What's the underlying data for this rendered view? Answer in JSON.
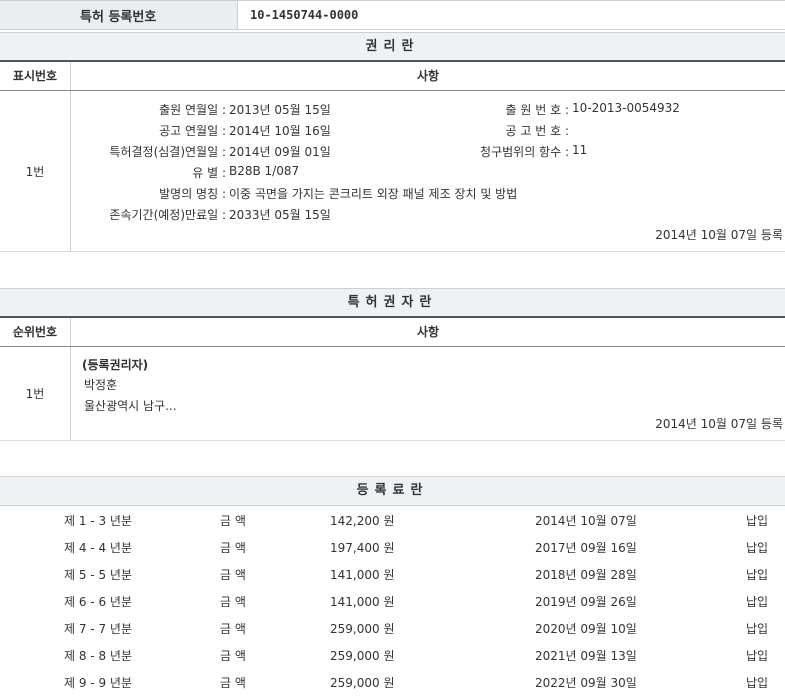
{
  "top": {
    "label": "특허 등록번호",
    "value": "10-1450744-0000"
  },
  "rights": {
    "title": "권리란",
    "col_num": "표시번호",
    "col_item": "사항",
    "num": "1번",
    "fields_left": [
      {
        "k": "출원 연월일 :",
        "v": "2013년 05월 15일"
      },
      {
        "k": "공고 연월일 :",
        "v": "2014년 10월 16일"
      },
      {
        "k": "특허결정(심결)연월일 :",
        "v": "2014년 09월 01일"
      },
      {
        "k": "유  별 :",
        "v": "B28B 1/087"
      },
      {
        "k": "발명의 명칭 :",
        "v": "이중 곡면을 가지는 콘크리트 외장 패널 제조 장치 및 방법"
      },
      {
        "k": "존속기간(예정)만료일 :",
        "v": "2033년 05월 15일"
      }
    ],
    "fields_right": [
      {
        "k": "출 원 번 호 :",
        "v": "10-2013-0054932"
      },
      {
        "k": "공 고 번 호 :",
        "v": ""
      },
      {
        "k": "청구범위의 항수 :",
        "v": "11"
      }
    ],
    "date": "2014년 10월 07일 등록"
  },
  "holders": {
    "title": "특허권자란",
    "col_num": "순위번호",
    "col_item": "사항",
    "num": "1번",
    "heading": "(등록권리자)",
    "name": "박정훈",
    "address": "울산광역시 남구...",
    "date": "2014년 10월 07일 등록"
  },
  "fees": {
    "title": "등록료란",
    "rows": [
      {
        "period": "제 1 - 3 년분",
        "label": "금 액",
        "amount": "142,200 원",
        "date": "2014년 10월 07일",
        "status": "납입"
      },
      {
        "period": "제 4 - 4 년분",
        "label": "금 액",
        "amount": "197,400 원",
        "date": "2017년 09월 16일",
        "status": "납입"
      },
      {
        "period": "제 5 - 5 년분",
        "label": "금 액",
        "amount": "141,000 원",
        "date": "2018년 09월 28일",
        "status": "납입"
      },
      {
        "period": "제 6 - 6 년분",
        "label": "금 액",
        "amount": "141,000 원",
        "date": "2019년 09월 26일",
        "status": "납입"
      },
      {
        "period": "제 7 - 7 년분",
        "label": "금 액",
        "amount": "259,000 원",
        "date": "2020년 09월 10일",
        "status": "납입"
      },
      {
        "period": "제 8 - 8 년분",
        "label": "금 액",
        "amount": "259,000 원",
        "date": "2021년 09월 13일",
        "status": "납입"
      },
      {
        "period": "제 9 - 9 년분",
        "label": "금 액",
        "amount": "259,000 원",
        "date": "2022년 09월 30일",
        "status": "납입"
      }
    ]
  }
}
